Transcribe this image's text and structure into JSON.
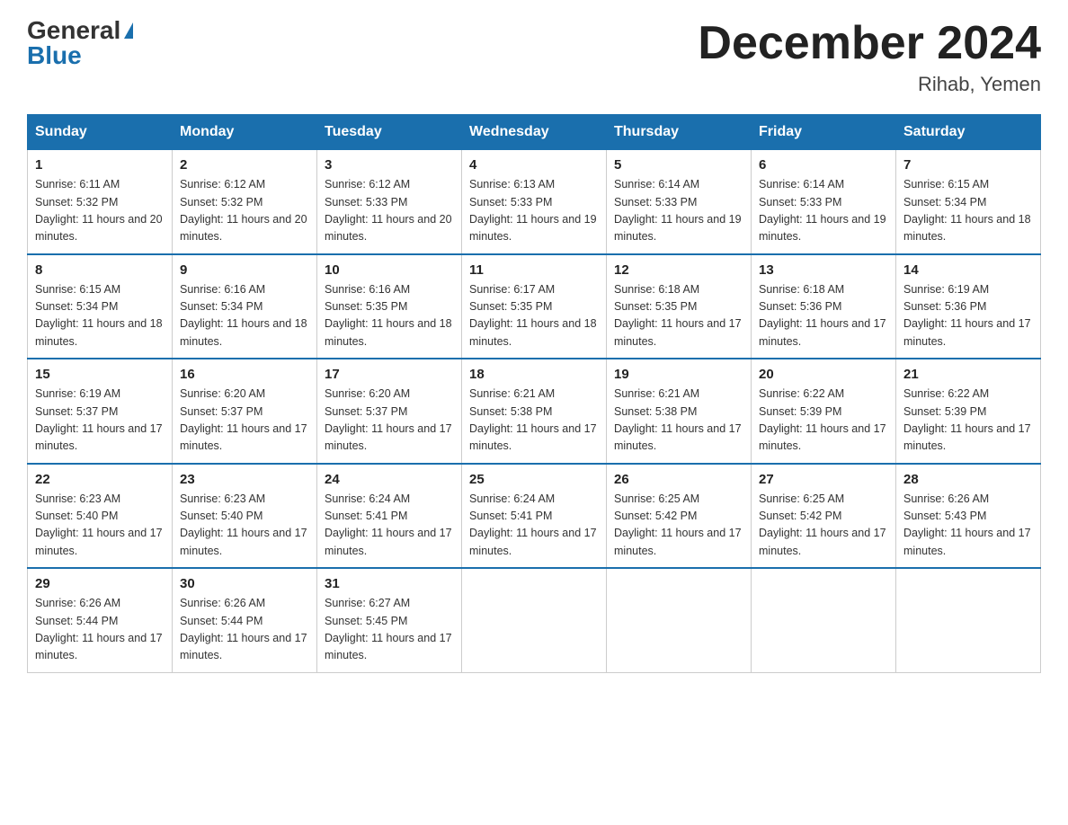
{
  "header": {
    "logo_general": "General",
    "logo_blue": "Blue",
    "month_title": "December 2024",
    "location": "Rihab, Yemen"
  },
  "days_of_week": [
    "Sunday",
    "Monday",
    "Tuesday",
    "Wednesday",
    "Thursday",
    "Friday",
    "Saturday"
  ],
  "weeks": [
    [
      {
        "day": "1",
        "sunrise": "6:11 AM",
        "sunset": "5:32 PM",
        "daylight": "11 hours and 20 minutes."
      },
      {
        "day": "2",
        "sunrise": "6:12 AM",
        "sunset": "5:32 PM",
        "daylight": "11 hours and 20 minutes."
      },
      {
        "day": "3",
        "sunrise": "6:12 AM",
        "sunset": "5:33 PM",
        "daylight": "11 hours and 20 minutes."
      },
      {
        "day": "4",
        "sunrise": "6:13 AM",
        "sunset": "5:33 PM",
        "daylight": "11 hours and 19 minutes."
      },
      {
        "day": "5",
        "sunrise": "6:14 AM",
        "sunset": "5:33 PM",
        "daylight": "11 hours and 19 minutes."
      },
      {
        "day": "6",
        "sunrise": "6:14 AM",
        "sunset": "5:33 PM",
        "daylight": "11 hours and 19 minutes."
      },
      {
        "day": "7",
        "sunrise": "6:15 AM",
        "sunset": "5:34 PM",
        "daylight": "11 hours and 18 minutes."
      }
    ],
    [
      {
        "day": "8",
        "sunrise": "6:15 AM",
        "sunset": "5:34 PM",
        "daylight": "11 hours and 18 minutes."
      },
      {
        "day": "9",
        "sunrise": "6:16 AM",
        "sunset": "5:34 PM",
        "daylight": "11 hours and 18 minutes."
      },
      {
        "day": "10",
        "sunrise": "6:16 AM",
        "sunset": "5:35 PM",
        "daylight": "11 hours and 18 minutes."
      },
      {
        "day": "11",
        "sunrise": "6:17 AM",
        "sunset": "5:35 PM",
        "daylight": "11 hours and 18 minutes."
      },
      {
        "day": "12",
        "sunrise": "6:18 AM",
        "sunset": "5:35 PM",
        "daylight": "11 hours and 17 minutes."
      },
      {
        "day": "13",
        "sunrise": "6:18 AM",
        "sunset": "5:36 PM",
        "daylight": "11 hours and 17 minutes."
      },
      {
        "day": "14",
        "sunrise": "6:19 AM",
        "sunset": "5:36 PM",
        "daylight": "11 hours and 17 minutes."
      }
    ],
    [
      {
        "day": "15",
        "sunrise": "6:19 AM",
        "sunset": "5:37 PM",
        "daylight": "11 hours and 17 minutes."
      },
      {
        "day": "16",
        "sunrise": "6:20 AM",
        "sunset": "5:37 PM",
        "daylight": "11 hours and 17 minutes."
      },
      {
        "day": "17",
        "sunrise": "6:20 AM",
        "sunset": "5:37 PM",
        "daylight": "11 hours and 17 minutes."
      },
      {
        "day": "18",
        "sunrise": "6:21 AM",
        "sunset": "5:38 PM",
        "daylight": "11 hours and 17 minutes."
      },
      {
        "day": "19",
        "sunrise": "6:21 AM",
        "sunset": "5:38 PM",
        "daylight": "11 hours and 17 minutes."
      },
      {
        "day": "20",
        "sunrise": "6:22 AM",
        "sunset": "5:39 PM",
        "daylight": "11 hours and 17 minutes."
      },
      {
        "day": "21",
        "sunrise": "6:22 AM",
        "sunset": "5:39 PM",
        "daylight": "11 hours and 17 minutes."
      }
    ],
    [
      {
        "day": "22",
        "sunrise": "6:23 AM",
        "sunset": "5:40 PM",
        "daylight": "11 hours and 17 minutes."
      },
      {
        "day": "23",
        "sunrise": "6:23 AM",
        "sunset": "5:40 PM",
        "daylight": "11 hours and 17 minutes."
      },
      {
        "day": "24",
        "sunrise": "6:24 AM",
        "sunset": "5:41 PM",
        "daylight": "11 hours and 17 minutes."
      },
      {
        "day": "25",
        "sunrise": "6:24 AM",
        "sunset": "5:41 PM",
        "daylight": "11 hours and 17 minutes."
      },
      {
        "day": "26",
        "sunrise": "6:25 AM",
        "sunset": "5:42 PM",
        "daylight": "11 hours and 17 minutes."
      },
      {
        "day": "27",
        "sunrise": "6:25 AM",
        "sunset": "5:42 PM",
        "daylight": "11 hours and 17 minutes."
      },
      {
        "day": "28",
        "sunrise": "6:26 AM",
        "sunset": "5:43 PM",
        "daylight": "11 hours and 17 minutes."
      }
    ],
    [
      {
        "day": "29",
        "sunrise": "6:26 AM",
        "sunset": "5:44 PM",
        "daylight": "11 hours and 17 minutes."
      },
      {
        "day": "30",
        "sunrise": "6:26 AM",
        "sunset": "5:44 PM",
        "daylight": "11 hours and 17 minutes."
      },
      {
        "day": "31",
        "sunrise": "6:27 AM",
        "sunset": "5:45 PM",
        "daylight": "11 hours and 17 minutes."
      },
      null,
      null,
      null,
      null
    ]
  ]
}
